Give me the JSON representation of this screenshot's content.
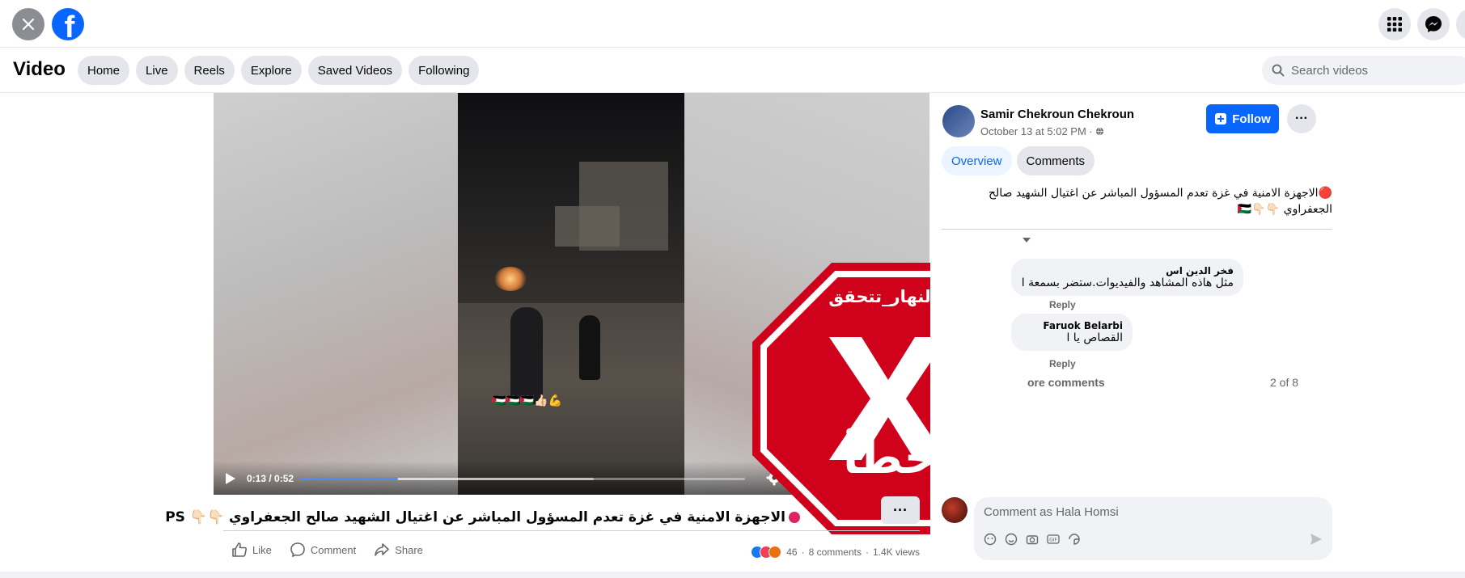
{
  "topbar": {
    "close_icon": "close-icon",
    "logo_icon": "facebook-logo-icon",
    "right_icons": [
      "menu-grid-icon",
      "messenger-icon"
    ]
  },
  "nav": {
    "title": "Video",
    "pills": [
      "Home",
      "Live",
      "Reels",
      "Explore",
      "Saved Videos",
      "Following"
    ],
    "search_placeholder": "Search videos"
  },
  "player": {
    "time": "0:13 / 0:52",
    "progress": 0.22,
    "buffered": 0.66,
    "overlay_emojis": "🇵🇸🇵🇸🇵🇸👍🏻💪",
    "controls": [
      "play-icon",
      "settings-icon",
      "captions-icon",
      "fullscreen-icon",
      "pip-icon",
      "volume-icon"
    ]
  },
  "stamp": {
    "hashtag": "#النهار_تتحقق",
    "verdict": "خطأ",
    "color": "#d0021b"
  },
  "post": {
    "caption": "الاجهزة الامنية في غزة تعدم المسؤول المباشر عن اغتيال الشهيد صالح الجعفراوي 👇🏻👇🏻 PS",
    "actions": [
      "Like",
      "Comment",
      "Share"
    ],
    "reaction_count": "46",
    "comments_count": "8 comments",
    "views": "1.4K views"
  },
  "side": {
    "poster_name": "Samir Chekroun Chekroun",
    "date": "October 13 at 5:02 PM ·",
    "follow_label": "Follow",
    "tabs": [
      "Overview",
      "Comments"
    ],
    "description_line1": "🔴الاجهزة الامنية في غزة تعدم المسؤول المباشر عن اغتيال الشهيد صالح",
    "description_line2": "الجعفراوي 👇🏻👇🏻🇵🇸",
    "comments": [
      {
        "name": "فخر الدين اس",
        "text": "مثل هاذه المشاهد والفيديوات.ستضر بسمعة ا",
        "meta": "Reply"
      },
      {
        "name": "Faruok Belarbi",
        "text": "القصاص يا ا",
        "meta": "Reply"
      }
    ],
    "view_more": "ore comments",
    "pager": "2 of 8",
    "comment_placeholder": "Comment as Hala Homsi"
  }
}
